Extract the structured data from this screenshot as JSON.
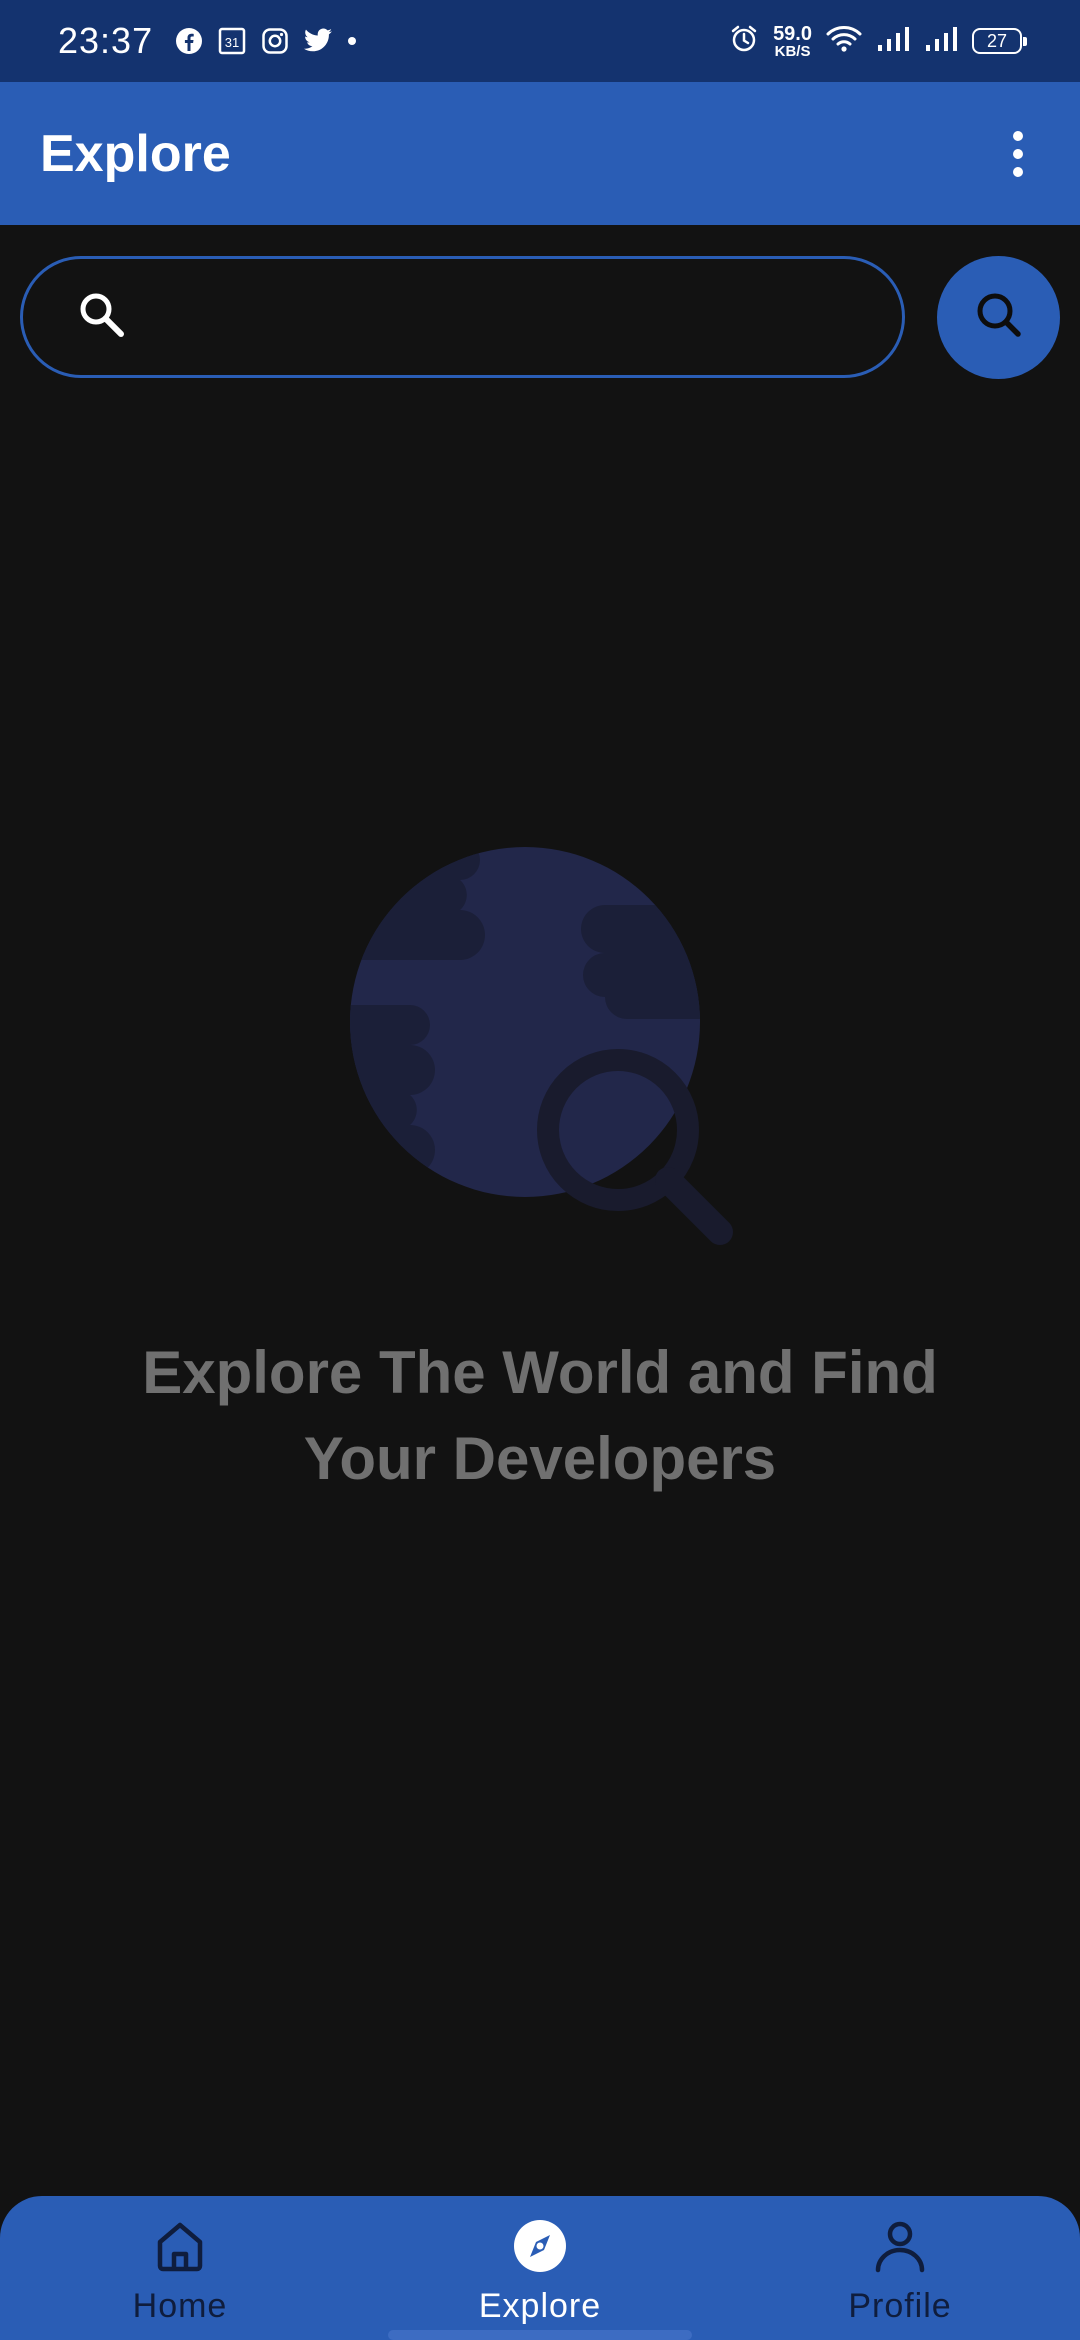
{
  "status_bar": {
    "time": "23:37",
    "calendar_day": "31",
    "net_speed_value": "59.0",
    "net_speed_unit": "KB/S",
    "battery": "27",
    "icons": [
      "facebook-icon",
      "calendar-icon",
      "instagram-icon",
      "twitter-icon",
      "dot-icon",
      "alarm-icon",
      "wifi-icon",
      "signal-icon",
      "signal-icon",
      "battery-icon"
    ]
  },
  "app_bar": {
    "title": "Explore",
    "menu_icon": "more-vert-icon"
  },
  "search": {
    "placeholder": "",
    "value": "",
    "leading_icon": "search-icon",
    "button_icon": "search-icon"
  },
  "empty_state": {
    "illustration": "globe-search-illustration",
    "message": "Explore The World and Find Your Developers"
  },
  "bottom_nav": {
    "items": [
      {
        "label": "Home",
        "icon": "home-icon",
        "active": false
      },
      {
        "label": "Explore",
        "icon": "compass-icon",
        "active": true
      },
      {
        "label": "Profile",
        "icon": "person-icon",
        "active": false
      }
    ]
  },
  "colors": {
    "status_bar": "#14336f",
    "primary": "#2a5db5",
    "background": "#121212",
    "empty_text": "#707070",
    "illustration_globe": "#22274a",
    "illustration_dark": "#1a1d33"
  }
}
